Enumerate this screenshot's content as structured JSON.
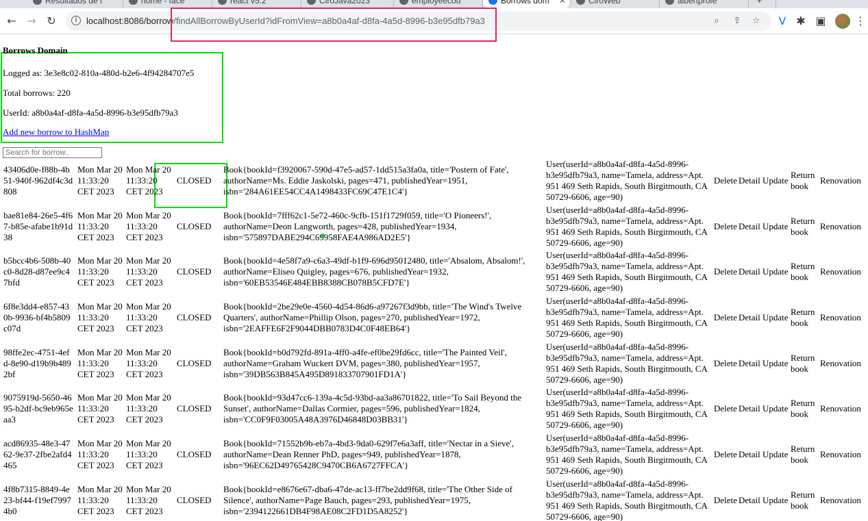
{
  "browser": {
    "tabs": [
      {
        "label": "Resultados de l"
      },
      {
        "label": "home - face"
      },
      {
        "label": "react v5.2"
      },
      {
        "label": "CiroJava2023"
      },
      {
        "label": "employeecou"
      },
      {
        "label": "Borrows dom"
      },
      {
        "label": "CiroWeb"
      },
      {
        "label": "albertprofe"
      }
    ],
    "url_host": "localhost:8086/borrow",
    "url_path": "/findAllBorrowByUserId?idFromView=a8b0a4af-d8fa-4a5d-8996-b3e95dfb79a3",
    "highlight_url_color": "#e0245e",
    "highlight_color": "#00e000"
  },
  "page": {
    "title": "Borrows Domain",
    "logged_as": "Logged as: 3e3e8c02-810a-480d-b2e6-4f94284707e5",
    "total_borrows": "Total borrows: 220",
    "user_id": "UserId: a8b0a4af-d8fa-4a5d-8996-b3e95dfb79a3",
    "add_link": "Add new borrow to HashMap",
    "search_placeholder": "Search for borrow.."
  },
  "actions": {
    "delete": "Delete",
    "detail": "Detail",
    "update": "Update",
    "return_book": "Return book",
    "renovation": "Renovation"
  },
  "borrows": [
    {
      "id": "43406d0e-f88b-4b51-940f-962df4c3d808",
      "date1": "Mon Mar 20 11:33:20 CET 2023",
      "date2": "Mon Mar 20 11:33:20 CET 2023",
      "status": "CLOSED",
      "book": "Book{bookId=f3920067-590d-47e5-ad57-1dd515a3fa0a, title='Postern of Fate', authorName=Ms. Eddie Jaskolski, pages=471, publishedYear=1951, isbn='284A61EE54CC4A1498433FC69C47E1C4'}",
      "user": "User(userId=a8b0a4af-d8fa-4a5d-8996-b3e95dfb79a3, name=Tamela, address=Apt. 951 469 Seth Rapids, South Birgitmouth, CA 50729-6606, age=90)"
    },
    {
      "id": "bae81e84-26e5-4f67-b85e-afabe1b91d38",
      "date1": "Mon Mar 20 11:33:20 CET 2023",
      "date2": "Mon Mar 20 11:33:20 CET 2023",
      "status": "CLOSED",
      "book": "Book{bookId=7fff62c1-5e72-460c-9cfb-151f1729f059, title='O Pioneers!', authorName=Deon Langworth, pages=428, publishedYear=1934, isbn='575897DABE294C69958FAE4A986AD2E5'}",
      "user": "User(userId=a8b0a4af-d8fa-4a5d-8996-b3e95dfb79a3, name=Tamela, address=Apt. 951 469 Seth Rapids, South Birgitmouth, CA 50729-6606, age=90)"
    },
    {
      "id": "b5bcc4b6-508b-40c0-8d28-d87ee9c47bfd",
      "date1": "Mon Mar 20 11:33:20 CET 2023",
      "date2": "Mon Mar 20 11:33:20 CET 2023",
      "status": "CLOSED",
      "book": "Book{bookId=4e58f7a9-c6a3-49df-b1f9-696d95012480, title='Absalom, Absalom!', authorName=Eliseo Quigley, pages=676, publishedYear=1932, isbn='60EB53546E484EBB8388CB078B5CFD7E'}",
      "user": "User(userId=a8b0a4af-d8fa-4a5d-8996-b3e95dfb79a3, name=Tamela, address=Apt. 951 469 Seth Rapids, South Birgitmouth, CA 50729-6606, age=90)"
    },
    {
      "id": "6f8e3dd4-e857-430b-9936-bf4b5809c07d",
      "date1": "Mon Mar 20 11:33:20 CET 2023",
      "date2": "Mon Mar 20 11:33:20 CET 2023",
      "status": "CLOSED",
      "book": "Book{bookId=2be29e0e-4560-4d54-86d6-a97267f3d9bb, title='The Wind's Twelve Quarters', authorName=Phillip Olson, pages=270, publishedYear=1972, isbn='2EAFFE6F2F9044DBB0783D4C0F48EB64'}",
      "user": "User(userId=a8b0a4af-d8fa-4a5d-8996-b3e95dfb79a3, name=Tamela, address=Apt. 951 469 Seth Rapids, South Birgitmouth, CA 50729-6606, age=90)"
    },
    {
      "id": "98ffe2ec-4751-4efd-8e90-d19b9b4892bf",
      "date1": "Mon Mar 20 11:33:20 CET 2023",
      "date2": "Mon Mar 20 11:33:20 CET 2023",
      "status": "CLOSED",
      "book": "Book{bookId=b0d792fd-891a-4ff0-a4fe-ef0be29fd6cc, title='The Painted Veil', authorName=Graham Wuckert DVM, pages=380, publishedYear=1957, isbn='39DB563B845A495D891833707901FD1A'}",
      "user": "User(userId=a8b0a4af-d8fa-4a5d-8996-b3e95dfb79a3, name=Tamela, address=Apt. 951 469 Seth Rapids, South Birgitmouth, CA 50729-6606, age=90)"
    },
    {
      "id": "9075919d-5650-4695-b2df-bc9eb965eaa3",
      "date1": "Mon Mar 20 11:33:20 CET 2023",
      "date2": "Mon Mar 20 11:33:20 CET 2023",
      "status": "CLOSED",
      "book": "Book{bookId=93d47cc6-139a-4c5d-93bd-aa3a86701822, title='To Sail Beyond the Sunset', authorName=Dallas Cormier, pages=596, publishedYear=1824, isbn='CC0F9F03005A48A3976D46848D03BB31'}",
      "user": "User(userId=a8b0a4af-d8fa-4a5d-8996-b3e95dfb79a3, name=Tamela, address=Apt. 951 469 Seth Rapids, South Birgitmouth, CA 50729-6606, age=90)"
    },
    {
      "id": "acd86935-48e3-4762-9e37-2fbe2afd4465",
      "date1": "Mon Mar 20 11:33:20 CET 2023",
      "date2": "Mon Mar 20 11:33:20 CET 2023",
      "status": "CLOSED",
      "book": "Book{bookId=71552b9b-eb7a-4bd3-9da0-629f7e6a3aff, title='Nectar in a Sieve', authorName=Dean Renner PhD, pages=949, publishedYear=1878, isbn='96EC62D49765428C9470CB6A6727FFCA'}",
      "user": "User(userId=a8b0a4af-d8fa-4a5d-8996-b3e95dfb79a3, name=Tamela, address=Apt. 951 469 Seth Rapids, South Birgitmouth, CA 50729-6606, age=90)"
    },
    {
      "id": "4f8b7315-8849-4e23-bf44-f19ef79974b0",
      "date1": "Mon Mar 20 11:33:20 CET 2023",
      "date2": "Mon Mar 20 11:33:20 CET 2023",
      "status": "CLOSED",
      "book": "Book{bookId=e8676e67-dba6-47de-ac13-ff7be2dd9f68, title='The Other Side of Silence', authorName=Page Bauch, pages=293, publishedYear=1975, isbn='2394122661DB4F98AE08C2FD1D5A8252'}",
      "user": "User(userId=a8b0a4af-d8fa-4a5d-8996-b3e95dfb79a3, name=Tamela, address=Apt. 951 469 Seth Rapids, South Birgitmouth, CA 50729-6606, age=90)"
    }
  ]
}
